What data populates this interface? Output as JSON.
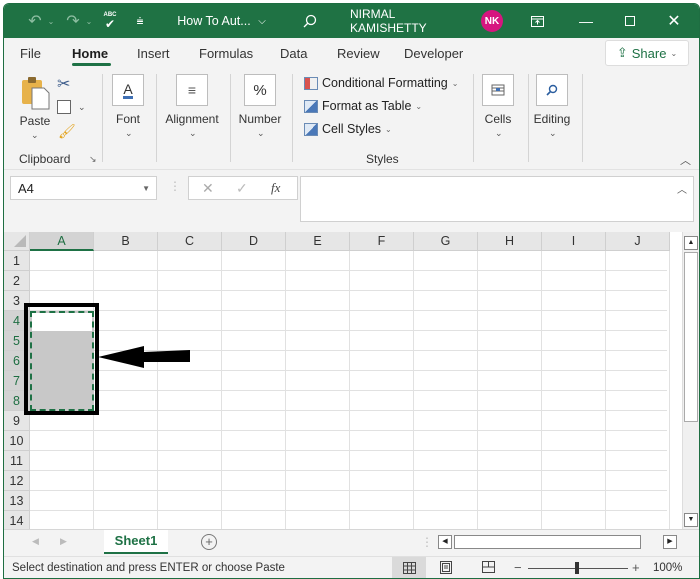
{
  "titlebar": {
    "document_title": "How To Aut...",
    "user_name": "NIRMAL KAMISHETTY",
    "avatar_initials": "NK",
    "avatar_color": "#d6157f",
    "brand_color": "#1f7244"
  },
  "menu_tabs": [
    "File",
    "Home",
    "Insert",
    "Formulas",
    "Data",
    "Review",
    "Developer"
  ],
  "active_tab": "Home",
  "share_label": "Share",
  "ribbon": {
    "paste_label": "Paste",
    "clipboard_label": "Clipboard",
    "font_label": "Font",
    "alignment_label": "Alignment",
    "number_label": "Number",
    "number_glyph": "%",
    "conditional_formatting": "Conditional Formatting",
    "format_as_table": "Format as Table",
    "cell_styles": "Cell Styles",
    "styles_label": "Styles",
    "cells_label": "Cells",
    "editing_label": "Editing"
  },
  "formula_bar": {
    "name_box": "A4",
    "fx_label": "fx",
    "formula_value": ""
  },
  "grid": {
    "columns": [
      "A",
      "B",
      "C",
      "D",
      "E",
      "F",
      "G",
      "H",
      "I",
      "J"
    ],
    "rows": [
      "1",
      "2",
      "3",
      "4",
      "5",
      "6",
      "7",
      "8",
      "9",
      "10",
      "11",
      "12",
      "13",
      "14"
    ],
    "active_cell": "A4",
    "selected_range": "A4:A8",
    "selected_column": "A",
    "selected_rows": [
      "4",
      "5",
      "6",
      "7",
      "8"
    ]
  },
  "sheets": {
    "tabs": [
      "Sheet1"
    ],
    "active": "Sheet1"
  },
  "status": {
    "message": "Select destination and press ENTER or choose Paste",
    "zoom": "100%",
    "zoom_minus": "−",
    "zoom_plus": "+"
  }
}
